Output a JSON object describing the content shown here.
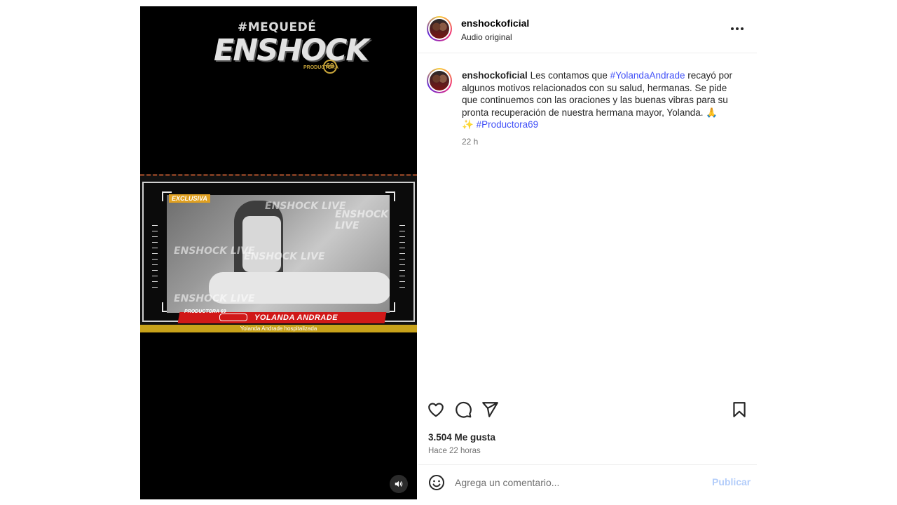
{
  "media": {
    "brand_hashtag": "#MEQUEDÉ",
    "brand_main": "ENSHOCK",
    "brand_sub": "PRODUCTORA",
    "brand_number": "69",
    "badge_exclusive": "EXCLUSIVA",
    "watermark": "ENSHOCK LIVE",
    "lower_third_producer": "PRODUCTORA 69",
    "lower_third_name": "YOLANDA ANDRADE",
    "ticker_text": "Yolanda Andrade hospitalizada",
    "mute_icon": "speaker-icon"
  },
  "header": {
    "username": "enshockoficial",
    "audio": "Audio original",
    "more_icon": "more-horizontal-icon"
  },
  "caption": {
    "username": "enshockoficial",
    "text_1": "Les contamos que ",
    "tag_1": "#YolandaAndrade",
    "text_2": " recayó por algunos motivos relacionados con su salud, hermanas. Se pide que continuemos con las oraciones y las buenas vibras para su pronta recuperación de nuestra hermana mayor, Yolanda. 🙏",
    "text_3": "✨ ",
    "tag_2": "#Productora69",
    "time": "22 h"
  },
  "actions": {
    "like_icon": "heart-icon",
    "comment_icon": "comment-icon",
    "share_icon": "send-icon",
    "save_icon": "bookmark-icon"
  },
  "stats": {
    "likes": "3.504 Me gusta",
    "posted": "Hace 22 horas"
  },
  "comment": {
    "placeholder": "Agrega un comentario...",
    "post_label": "Publicar",
    "emoji_icon": "emoji-icon"
  },
  "colors": {
    "link": "#4150f7",
    "post_disabled": "#b3cdfa",
    "ticker": "#c8a21a",
    "lower_third": "#d01818"
  }
}
